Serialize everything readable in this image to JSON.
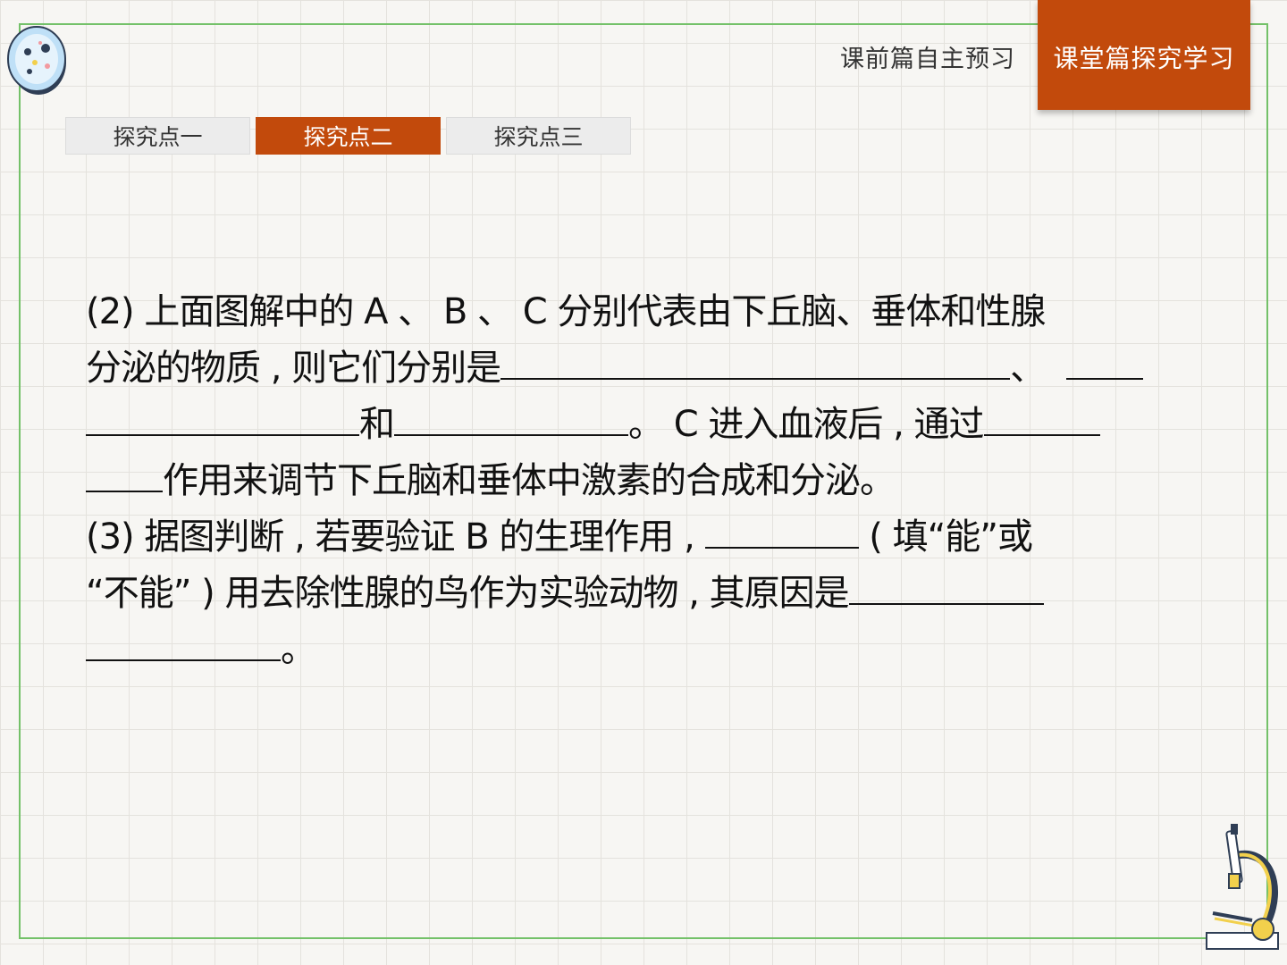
{
  "nav": {
    "preview_label": "课前篇自主预习",
    "active_label": "课堂篇探究学习"
  },
  "tabs": [
    {
      "label": "探究点一"
    },
    {
      "label": "探究点二"
    },
    {
      "label": "探究点三"
    }
  ],
  "question2": {
    "line1": "(2) 上面图解中的 A 、 B 、 C 分别代表由下丘脑、垂体和性腺",
    "line2_text": "分泌的物质 , 则它们分别是",
    "sep1": "、",
    "line3_and": "和",
    "line3_end": "。 C 进入血液后 , 通过",
    "line4_text": "作用来调节下丘脑和垂体中激素的合成和分泌。"
  },
  "question3": {
    "line1_text": "(3) 据图判断 , 若要验证 B 的生理作用 ,",
    "line1_end": "( 填“能”或",
    "line2_text": "“不能” ) 用去除性腺的鸟作为实验动物 , 其原因是",
    "line3_end": "。"
  },
  "colors": {
    "accent": "#c24a0c",
    "frame": "#74c169"
  }
}
